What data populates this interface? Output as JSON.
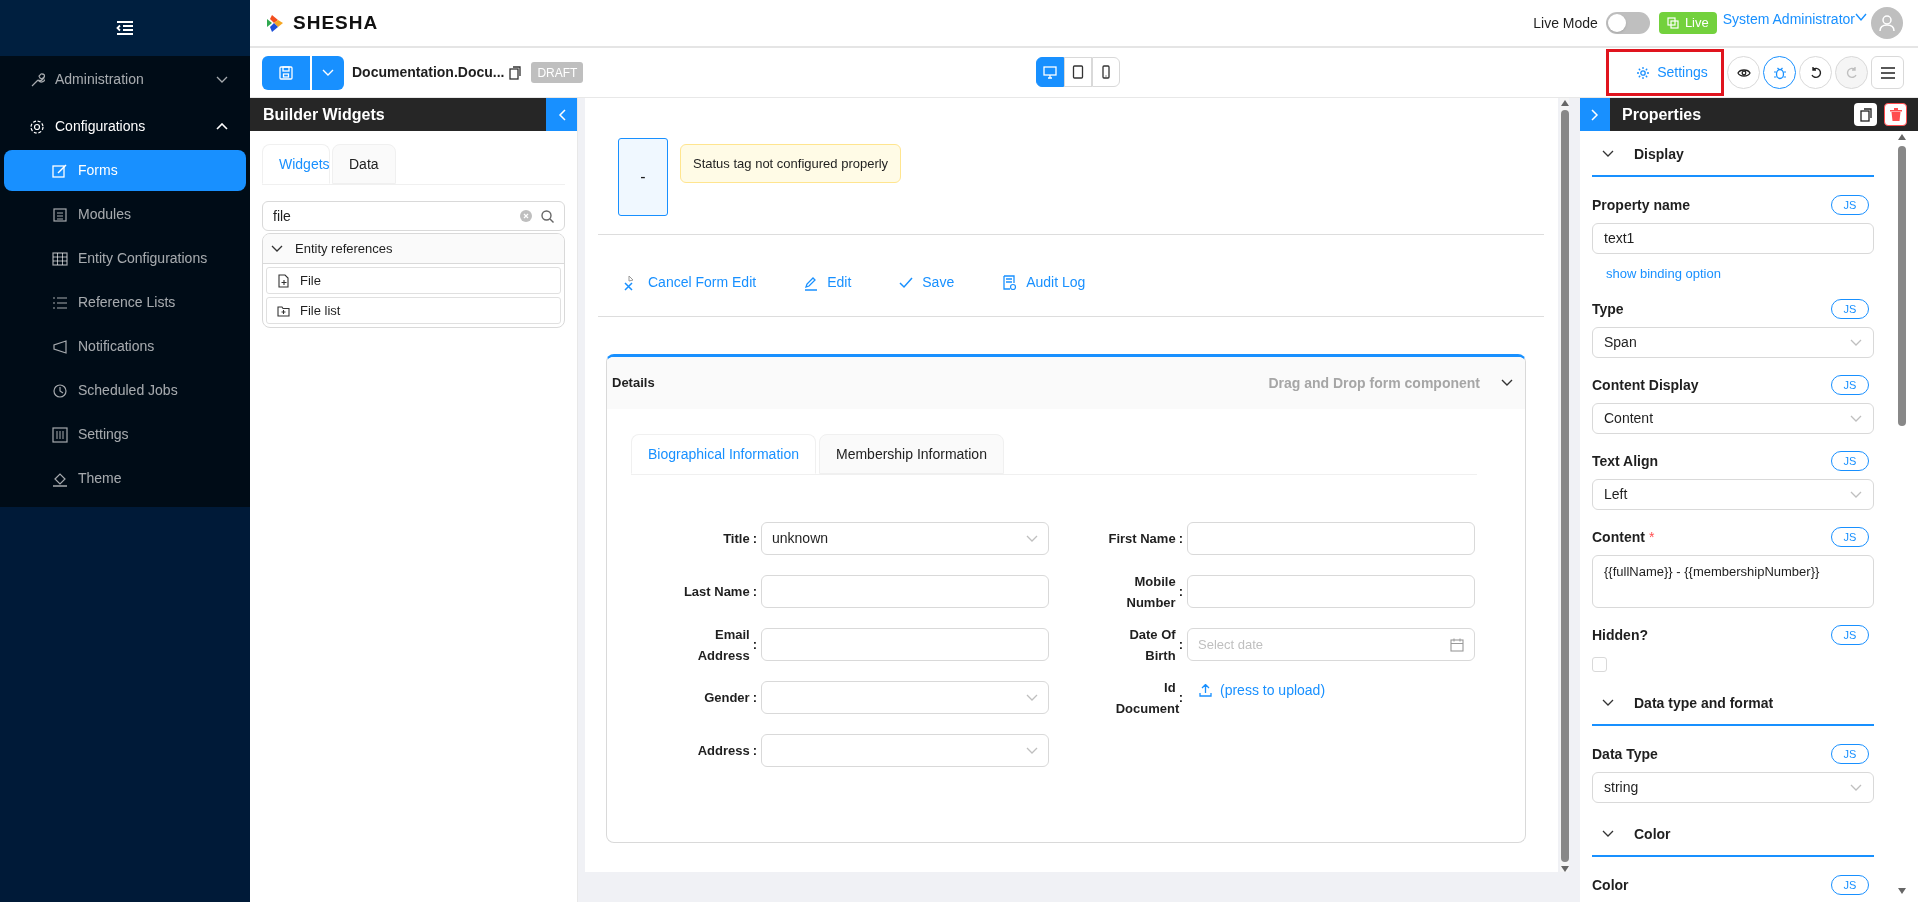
{
  "sidebar": {
    "menu": [
      {
        "label": "Administration",
        "expanded": false
      },
      {
        "label": "Configurations",
        "expanded": true,
        "children": [
          {
            "label": "Forms",
            "selected": true
          },
          {
            "label": "Modules",
            "selected": false
          },
          {
            "label": "Entity Configurations",
            "selected": false
          },
          {
            "label": "Reference Lists",
            "selected": false
          },
          {
            "label": "Notifications",
            "selected": false
          },
          {
            "label": "Scheduled Jobs",
            "selected": false
          },
          {
            "label": "Settings",
            "selected": false
          },
          {
            "label": "Theme",
            "selected": false
          }
        ]
      }
    ]
  },
  "header": {
    "logo": "SHESHA",
    "live_mode": {
      "label": "Live Mode",
      "on": false
    },
    "live_badge": "Live",
    "user": "System Administrator"
  },
  "toolbar": {
    "form_name": "Documentation.Docu...",
    "status": "DRAFT",
    "devices": [
      {
        "selected": true
      },
      {
        "selected": false
      },
      {
        "selected": false
      }
    ],
    "settings": "Settings",
    "actions": [
      {
        "active": false,
        "disabled": false
      },
      {
        "active": true,
        "disabled": false
      },
      {
        "active": false,
        "disabled": false
      },
      {
        "active": false,
        "disabled": true
      }
    ]
  },
  "builder": {
    "title": "Builder Widgets",
    "tabs": [
      {
        "label": "Widgets",
        "selected": true
      },
      {
        "label": "Data",
        "selected": false
      }
    ],
    "search": "file",
    "groups": [
      {
        "title": "Entity references",
        "expanded": true,
        "items": [
          "File",
          "File list"
        ]
      }
    ]
  },
  "canvas": {
    "status_value": "-",
    "status_tag": "Status tag not configured properly",
    "actions": [
      "Cancel Form Edit",
      "Edit",
      "Save",
      "Audit Log"
    ],
    "panel": {
      "title": "Details",
      "hint": "Drag and Drop form component",
      "tabs": [
        {
          "label": "Biographical Information",
          "selected": true
        },
        {
          "label": "Membership Information",
          "selected": false
        }
      ],
      "label_suffix": ":",
      "columns": [
        [
          {
            "label": "Title",
            "kind": "select",
            "value": "unknown"
          },
          {
            "label": "Last Name",
            "kind": "input"
          },
          {
            "label": "Email Address",
            "kind": "input"
          },
          {
            "label": "Gender",
            "kind": "select"
          },
          {
            "label": "Address",
            "kind": "select"
          }
        ],
        [
          {
            "label": "First Name",
            "kind": "input"
          },
          {
            "label": "Mobile Number",
            "kind": "input"
          },
          {
            "label": "Date Of Birth",
            "kind": "date",
            "placeholder": "Select date"
          },
          {
            "label": "Id Document",
            "kind": "upload",
            "value": "(press to upload)"
          }
        ]
      ]
    }
  },
  "properties": {
    "title": "Properties",
    "sections": [
      {
        "title": "Display",
        "expanded": true,
        "items": [
          {
            "label": "Property name",
            "js": "JS",
            "kind": "input",
            "value": "text1",
            "link": "show binding option"
          },
          {
            "label": "Type",
            "js": "JS",
            "kind": "select",
            "value": "Span"
          },
          {
            "label": "Content Display",
            "js": "JS",
            "kind": "select",
            "value": "Content"
          },
          {
            "label": "Text Align",
            "js": "JS",
            "kind": "select",
            "value": "Left"
          },
          {
            "label": "Content",
            "js": "JS",
            "required_mark": "*",
            "kind": "textarea",
            "value": "{{fullName}} - {{membershipNumber}}"
          },
          {
            "label": "Hidden?",
            "js": "JS",
            "kind": "checkbox",
            "checked": false
          }
        ]
      },
      {
        "title": "Data type and format",
        "expanded": true,
        "items": [
          {
            "label": "Data Type",
            "js": "JS",
            "kind": "select",
            "value": "string"
          }
        ]
      },
      {
        "title": "Color",
        "expanded": true,
        "items": [
          {
            "label": "Color",
            "js": "JS",
            "kind": "cut"
          }
        ]
      }
    ]
  }
}
